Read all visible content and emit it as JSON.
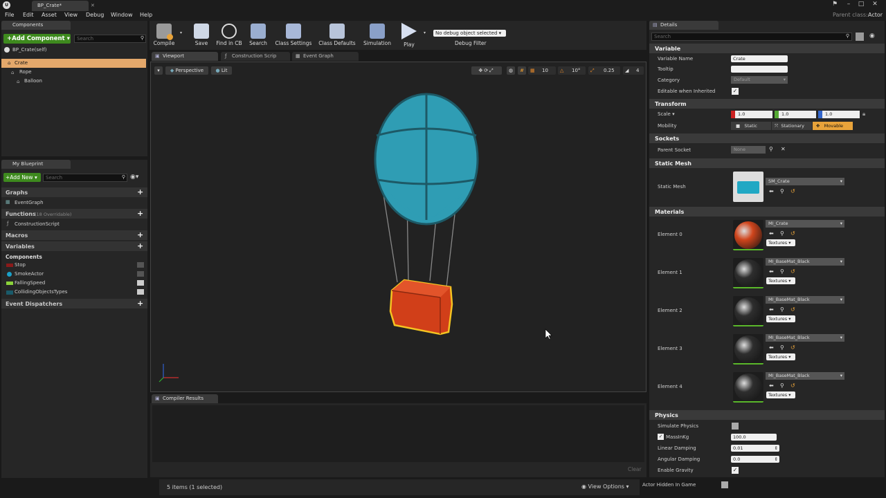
{
  "window": {
    "tab_title": "BP_Crate*",
    "parent_label": "Parent class:",
    "parent_value": "Actor"
  },
  "menu": [
    "File",
    "Edit",
    "Asset",
    "View",
    "Debug",
    "Window",
    "Help"
  ],
  "components": {
    "tab": "Components",
    "add_label": "+Add Component",
    "search_placeholder": "Search",
    "self_label": "BP_Crate(self)",
    "tree": [
      {
        "label": "Crate",
        "selected": true
      },
      {
        "label": "Rope",
        "selected": false
      },
      {
        "label": "Balloon",
        "selected": false
      }
    ]
  },
  "my_blueprint": {
    "tab": "My Blueprint",
    "add_label": "+Add New",
    "search_placeholder": "Search",
    "graphs": "Graphs",
    "graph_item": "EventGraph",
    "functions": "Functions",
    "functions_note": "(18 Overridable)",
    "function_item": "ConstructionScript",
    "macros": "Macros",
    "variables": "Variables",
    "components_cat": "Components",
    "vars": [
      {
        "label": "Stop",
        "color": "#8a1a1a"
      },
      {
        "label": "SmokeActor",
        "color": "#1aa0c8"
      },
      {
        "label": "FallingSpeed",
        "color": "#8bd23a"
      },
      {
        "label": "CollidingObjectsTypes",
        "color": "#1a5a6a"
      }
    ],
    "event_dispatchers": "Event Dispatchers"
  },
  "toolbar": {
    "compile": "Compile",
    "save": "Save",
    "find": "Find in CB",
    "search": "Search",
    "class_settings": "Class Settings",
    "class_defaults": "Class Defaults",
    "simulation": "Simulation",
    "play": "Play",
    "debug_select": "No debug object selected",
    "debug_filter": "Debug Filter"
  },
  "tabs": {
    "viewport": "Viewport",
    "construction": "Construction Scrip",
    "event_graph": "Event Graph"
  },
  "viewport": {
    "perspective": "Perspective",
    "lit": "Lit",
    "grid_snap": "10",
    "rot_snap": "10°",
    "scale_snap": "0.25",
    "cam_speed": "4"
  },
  "compiler": {
    "tab": "Compiler Results",
    "clear": "Clear"
  },
  "status": {
    "items": "5 items (1 selected)",
    "view_options": "View Options"
  },
  "details": {
    "tab": "Details",
    "search_placeholder": "Search",
    "variable": {
      "title": "Variable",
      "name_label": "Variable Name",
      "name_value": "Crate",
      "tooltip_label": "Tooltip",
      "tooltip_value": "",
      "category_label": "Category",
      "category_value": "Default",
      "editable_label": "Editable when Inherited"
    },
    "transform": {
      "title": "Transform",
      "scale_label": "Scale",
      "x": "1.0",
      "y": "1.0",
      "z": "1.0",
      "mobility_label": "Mobility",
      "static": "Static",
      "stationary": "Stationary",
      "movable": "Movable"
    },
    "sockets": {
      "title": "Sockets",
      "parent_label": "Parent Socket",
      "parent_value": "None"
    },
    "static_mesh": {
      "title": "Static Mesh",
      "label": "Static Mesh",
      "value": "SM_Crate"
    },
    "materials": {
      "title": "Materials",
      "elements": [
        {
          "label": "Element 0",
          "value": "MI_Crate",
          "color": "#d0451c"
        },
        {
          "label": "Element 1",
          "value": "MI_BaseMat_Black",
          "color": "#2e2e2e"
        },
        {
          "label": "Element 2",
          "value": "MI_BaseMat_Black",
          "color": "#2e2e2e"
        },
        {
          "label": "Element 3",
          "value": "MI_BaseMat_Black",
          "color": "#2e2e2e"
        },
        {
          "label": "Element 4",
          "value": "MI_BaseMat_Black",
          "color": "#2e2e2e"
        }
      ],
      "textures": "Textures"
    },
    "physics": {
      "title": "Physics",
      "simulate": "Simulate Physics",
      "mass_label": "MassInKg",
      "mass_value": "100.0",
      "linear_label": "Linear Damping",
      "linear_value": "0.01",
      "angular_label": "Angular Damping",
      "angular_value": "0.0",
      "gravity_label": "Enable Gravity"
    },
    "actor_hidden": "Actor Hidden In Game"
  }
}
